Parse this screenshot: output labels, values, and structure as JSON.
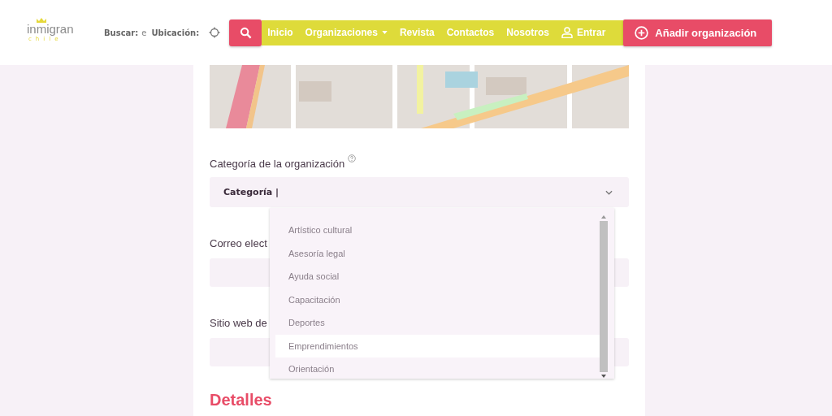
{
  "header": {
    "logo": {
      "word": "inmigran",
      "tagline": "chile"
    },
    "search_label": "Buscar:",
    "search_value": "e",
    "location_label": "Ubicación:",
    "nav": [
      {
        "label": "Inicio",
        "kind": "link"
      },
      {
        "label": "Organizaciones",
        "kind": "dropdown"
      },
      {
        "label": "Revista",
        "kind": "link"
      },
      {
        "label": "Contactos",
        "kind": "link"
      },
      {
        "label": "Nosotros",
        "kind": "link"
      },
      {
        "label": "Entrar",
        "kind": "user"
      }
    ],
    "add_button": "Añadir organización"
  },
  "form": {
    "category": {
      "label": "Categoría de la organización",
      "value": "Categoría |",
      "expanded": true,
      "options": [
        {
          "label": "Artístico cultural",
          "selected": false
        },
        {
          "label": "Asesoría legal",
          "selected": false
        },
        {
          "label": "Ayuda social",
          "selected": false
        },
        {
          "label": "Capacitación",
          "selected": false
        },
        {
          "label": "Deportes",
          "selected": false
        },
        {
          "label": "Emprendimientos",
          "selected": true
        },
        {
          "label": "Orientación",
          "selected": false
        }
      ]
    },
    "fields": [
      {
        "label": "Correo elect"
      },
      {
        "label": "Sitio web de"
      }
    ],
    "section_title": "Detalles"
  }
}
